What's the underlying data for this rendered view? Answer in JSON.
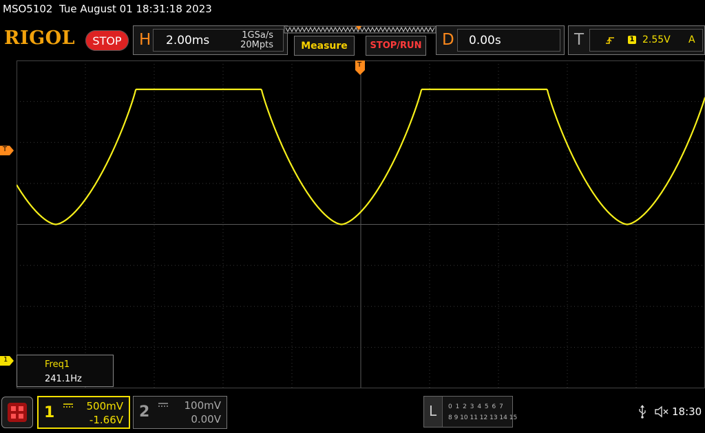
{
  "header": {
    "model": "MSO5102",
    "datetime": "Tue August 01 18:31:18 2023",
    "logo": "RIGOL",
    "run_state": "STOP"
  },
  "horizontal": {
    "letter": "H",
    "timebase": "2.00ms",
    "sample_rate": "1GSa/s",
    "memory_depth": "20Mpts"
  },
  "buttons": {
    "measure": "Measure",
    "stop_run": "STOP/RUN"
  },
  "delay": {
    "letter": "D",
    "value": "0.00s"
  },
  "trigger": {
    "letter": "T",
    "source": "1",
    "level": "2.55V",
    "mode": "A"
  },
  "markers": {
    "trigger_level": "T",
    "ch1": "1",
    "trigger_position": "T"
  },
  "measurement": {
    "name": "Freq1",
    "value": "241.1Hz"
  },
  "channels": [
    {
      "num": "1",
      "scale": "500mV",
      "offset": "-1.66V",
      "color": "#f5e000"
    },
    {
      "num": "2",
      "scale": "100mV",
      "offset": "0.00V",
      "color": "#9a9a9a"
    }
  ],
  "logic": {
    "letter": "L",
    "row1": "0 1 2 3   4 5 6 7",
    "row2": "8 9 10 11 12 13 14 15"
  },
  "status": {
    "time": "18:30",
    "usb_icon": "usb-icon",
    "volume_icon": "speaker-muted-icon"
  },
  "waveform": {
    "color": "#f7f01a",
    "period_divs": 4.15,
    "first_min_div": 0.57
  }
}
